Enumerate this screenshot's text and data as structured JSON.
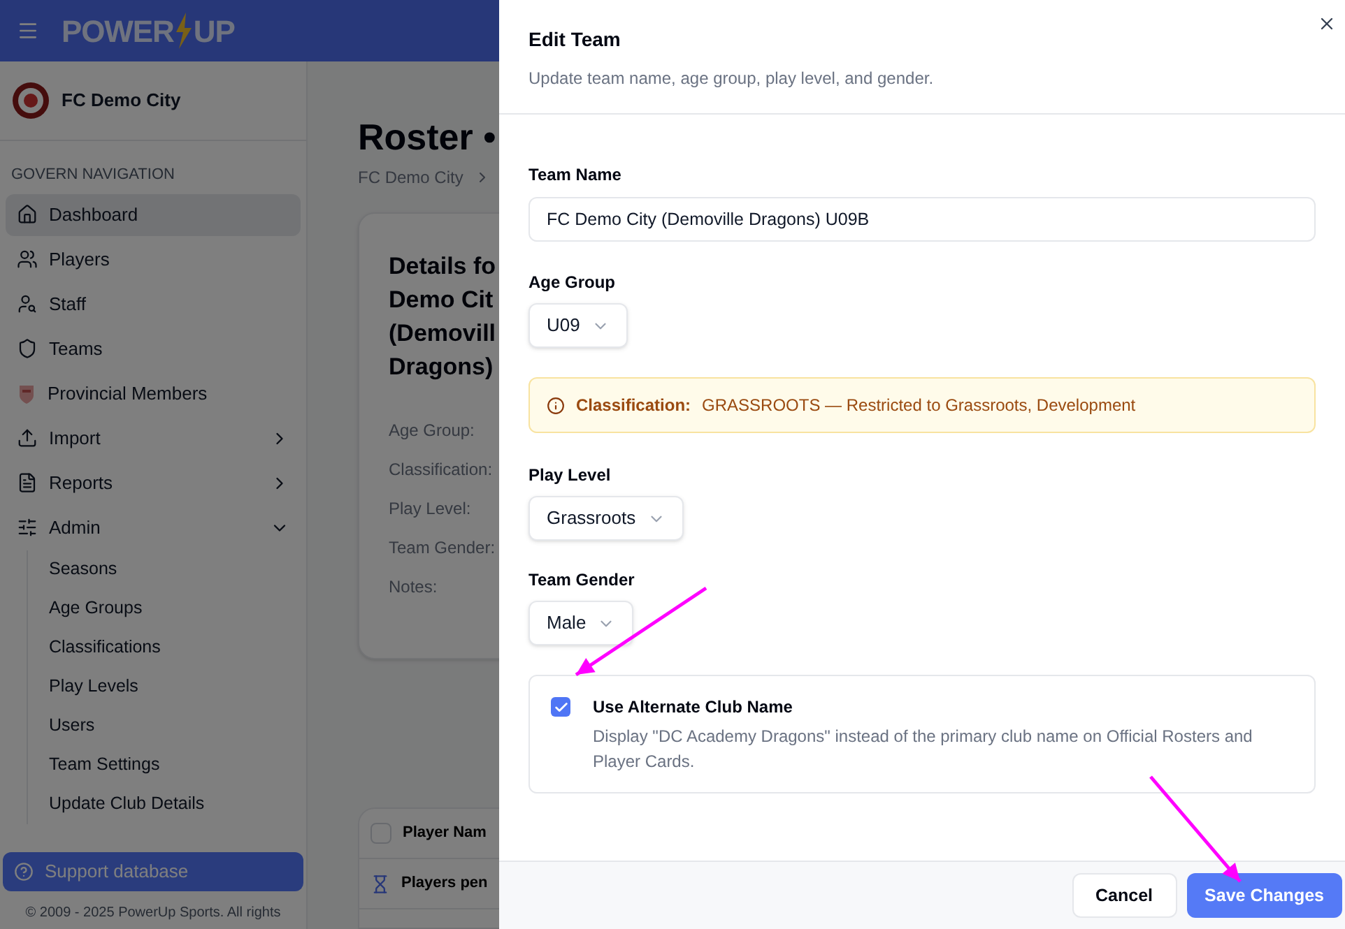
{
  "app_bar": {
    "logo": [
      "POWER",
      "UP"
    ]
  },
  "sidebar": {
    "club": "FC Demo City",
    "section_label": "GOVERN NAVIGATION",
    "items": [
      {
        "label": "Dashboard",
        "selected": true
      },
      {
        "label": "Players",
        "selected": false
      },
      {
        "label": "Staff",
        "selected": false
      },
      {
        "label": "Teams",
        "selected": false
      },
      {
        "label": "Provincial Members",
        "selected": false
      },
      {
        "label": "Import",
        "selected": false,
        "expanded": false
      },
      {
        "label": "Reports",
        "selected": false,
        "expanded": false
      },
      {
        "label": "Admin",
        "selected": false,
        "expanded": true,
        "children": [
          {
            "label": "Seasons"
          },
          {
            "label": "Age Groups"
          },
          {
            "label": "Classifications"
          },
          {
            "label": "Play Levels"
          },
          {
            "label": "Users"
          },
          {
            "label": "Team Settings"
          },
          {
            "label": "Update Club Details"
          }
        ]
      }
    ],
    "support_button": "Support database",
    "copyright": "© 2009 - 2025 PowerUp Sports. All rights"
  },
  "page": {
    "title": "Roster •",
    "breadcrumb": "FC Demo City",
    "details_heading": [
      "Details fo",
      "Demo Cit",
      "(Demovill",
      "Dragons)"
    ],
    "detail_labels": [
      "Age Group:",
      "Classification:",
      "Play Level:",
      "Team Gender:",
      "Notes:"
    ],
    "table": {
      "select_all_checked": false,
      "column_1": "Player Nam",
      "group_row": "Players pen"
    }
  },
  "dialog": {
    "title": "Edit Team",
    "subtitle": "Update team name, age group, play level, and gender.",
    "team_name": {
      "label": "Team Name",
      "value": "FC Demo City (Demoville Dragons) U09B"
    },
    "age_group": {
      "label": "Age Group",
      "value": "U09"
    },
    "notice": {
      "label": "Classification:",
      "text": "GRASSROOTS — Restricted to Grassroots, Development"
    },
    "play_level": {
      "label": "Play Level",
      "value": "Grassroots"
    },
    "team_gender": {
      "label": "Team Gender",
      "value": "Male"
    },
    "alternate_name": {
      "checked": true,
      "title": "Use Alternate Club Name",
      "description": "Display \"DC Academy Dragons\" instead of the primary club name on Official Rosters and Player Cards."
    },
    "buttons": {
      "cancel": "Cancel",
      "save": "Save Changes"
    }
  }
}
